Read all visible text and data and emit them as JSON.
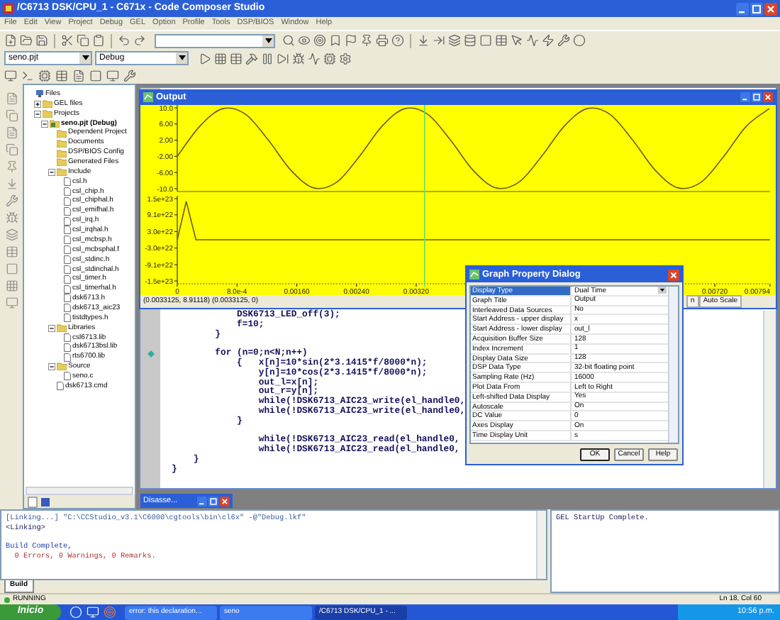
{
  "window": {
    "title": "/C6713 DSK/CPU_1 - C671x - Code Composer Studio"
  },
  "menu": [
    "File",
    "Edit",
    "View",
    "Project",
    "Debug",
    "GEL",
    "Option",
    "Profile",
    "Tools",
    "DSP/BIOS",
    "Window",
    "Help"
  ],
  "toolbar": {
    "project_combo": "seno.pjt",
    "config_combo": "Debug"
  },
  "project_tree": [
    {
      "label": "Files",
      "kind": "root",
      "children": [
        {
          "label": "GEL files",
          "kind": "folder",
          "expanded": false
        },
        {
          "label": "Projects",
          "kind": "folder",
          "expanded": true,
          "children": [
            {
              "label": "seno.pjt (Debug)",
              "kind": "project",
              "expanded": true,
              "children": [
                {
                  "label": "Dependent Project",
                  "kind": "folder"
                },
                {
                  "label": "Documents",
                  "kind": "folder"
                },
                {
                  "label": "DSP/BIOS Config",
                  "kind": "folder"
                },
                {
                  "label": "Generated Files",
                  "kind": "folder"
                },
                {
                  "label": "Include",
                  "kind": "folder",
                  "expanded": true,
                  "children": [
                    {
                      "label": "csl.h",
                      "kind": "file"
                    },
                    {
                      "label": "csl_chip.h",
                      "kind": "file"
                    },
                    {
                      "label": "csl_chiphal.h",
                      "kind": "file"
                    },
                    {
                      "label": "csl_emifhal.h",
                      "kind": "file"
                    },
                    {
                      "label": "csl_irq.h",
                      "kind": "file"
                    },
                    {
                      "label": "csl_irqhal.h",
                      "kind": "file"
                    },
                    {
                      "label": "csl_mcbsp.h",
                      "kind": "file"
                    },
                    {
                      "label": "csl_mcbsphal.f",
                      "kind": "file"
                    },
                    {
                      "label": "csl_stdinc.h",
                      "kind": "file"
                    },
                    {
                      "label": "csl_stdinchal.h",
                      "kind": "file"
                    },
                    {
                      "label": "csl_timer.h",
                      "kind": "file"
                    },
                    {
                      "label": "csl_timerhal.h",
                      "kind": "file"
                    },
                    {
                      "label": "dsk6713.h",
                      "kind": "file"
                    },
                    {
                      "label": "dsk6713_aic23",
                      "kind": "file"
                    },
                    {
                      "label": "tistdtypes.h",
                      "kind": "file"
                    }
                  ]
                },
                {
                  "label": "Libraries",
                  "kind": "folder",
                  "expanded": true,
                  "children": [
                    {
                      "label": "csl6713.lib",
                      "kind": "file"
                    },
                    {
                      "label": "dsk6713bsl.lib",
                      "kind": "file"
                    },
                    {
                      "label": "rts6700.lib",
                      "kind": "file"
                    }
                  ]
                },
                {
                  "label": "Source",
                  "kind": "folder",
                  "expanded": true,
                  "children": [
                    {
                      "label": "seno.c",
                      "kind": "file"
                    }
                  ]
                },
                {
                  "label": "dsk6713.cmd",
                  "kind": "file"
                }
              ]
            }
          ]
        }
      ]
    }
  ],
  "output_window": {
    "title": "Output",
    "upper_chart": {
      "chart_data": {
        "type": "line",
        "xlim": [
          0,
          0.00794
        ],
        "ylim": [
          -10,
          10
        ],
        "yticks": [
          {
            "value": 10,
            "label": "10.0"
          },
          {
            "value": 6,
            "label": "6.00"
          },
          {
            "value": 2,
            "label": "2.00"
          },
          {
            "value": -2,
            "label": "-2.00"
          },
          {
            "value": -6,
            "label": "-6.00"
          },
          {
            "value": -10,
            "label": "-10.0"
          }
        ],
        "x": [
          0,
          0.000305,
          0.00061,
          0.000915,
          0.00122,
          0.001525,
          0.00183,
          0.002135,
          0.00244,
          0.002745,
          0.00305,
          0.003355,
          0.00366,
          0.003965,
          0.00427,
          0.004575,
          0.00488,
          0.005185,
          0.00549,
          0.005795,
          0.0061,
          0.006405,
          0.00671,
          0.007015,
          0.00732,
          0.007625,
          0.00793
        ],
        "series": [
          {
            "color": "#6b5a10",
            "values": [
              -2,
              5.5,
              9.8,
              8.4,
              2,
              -5.5,
              -9.8,
              -8.4,
              -2,
              5.5,
              9.8,
              8.4,
              2,
              -5.5,
              -9.8,
              -8.4,
              -2,
              5.5,
              9.8,
              8.4,
              2,
              -5.5,
              -9.8,
              -8.4,
              -2,
              5.5,
              9.8
            ]
          }
        ],
        "ref_lines": [
          {
            "axis": "x",
            "value": 0.0033125,
            "color": "#66dd66"
          }
        ]
      }
    },
    "lower_chart": {
      "chart_data": {
        "type": "line",
        "xlim": [
          0,
          0.00794
        ],
        "ylim": [
          -1.5e+23,
          1.5e+23
        ],
        "yticks": [
          {
            "value": 1.5e+23,
            "label": "1.5e+23"
          },
          {
            "value": 9.1e+22,
            "label": "9.1e+22"
          },
          {
            "value": 3e+22,
            "label": "3.0e+22"
          },
          {
            "value": -3e+22,
            "label": "-3.0e+22"
          },
          {
            "value": -9.1e+22,
            "label": "-9.1e+22"
          },
          {
            "value": -1.5e+23,
            "label": "-1.5e+23"
          }
        ],
        "xticks": [
          {
            "value": 0,
            "label": "0"
          },
          {
            "value": 0.0008,
            "label": "8.0e-4"
          },
          {
            "value": 0.0016,
            "label": "0.00160"
          },
          {
            "value": 0.0024,
            "label": "0.00240"
          },
          {
            "value": 0.0032,
            "label": "0.00320"
          },
          {
            "value": 0.0072,
            "label": "0.00720"
          },
          {
            "value": 0.00794,
            "label": "0.00794"
          }
        ],
        "x": [
          0,
          0.00012,
          0.00025,
          0.00794
        ],
        "series": [
          {
            "color": "#6b5a10",
            "values": [
              0,
              1.4e+23,
              0,
              0
            ]
          }
        ],
        "ref_lines": [
          {
            "axis": "x",
            "value": 0.0033125,
            "color": "#66dd66"
          }
        ]
      }
    },
    "cursor_readout": "(0.0033125, 8.91118) (0.0033125, 0)",
    "readout_tabs": [
      "n",
      "Auto Scale"
    ]
  },
  "editor": {
    "lines": [
      {
        "text": "            DSK6713_LED_off(3);",
        "marker": false
      },
      {
        "text": "            f=10;",
        "marker": false
      },
      {
        "text": "        }",
        "marker": false
      },
      {
        "marker": false
      },
      {
        "text": "        for (n=0;n<N;n++)",
        "marker": true
      },
      {
        "text": "            {   x[n]=10*sin(2*3.1415*f/8000*n);",
        "marker": false
      },
      {
        "text": "                y[n]=10*cos(2*3.1415*f/8000*n);",
        "marker": false
      },
      {
        "text": "                out_l=x[n];",
        "marker": false
      },
      {
        "text": "                out_r=y[n];",
        "marker": false
      },
      {
        "text": "                while(!DSK6713_AIC23_write(el_handle0,",
        "marker": false
      },
      {
        "text": "                while(!DSK6713_AIC23_write(el_handle0,",
        "marker": false
      },
      {
        "text": "            }",
        "marker": false
      },
      {
        "marker": false
      },
      {
        "text": "                while(!DSK6713_AIC23_read(el_handle0,",
        "marker": false
      },
      {
        "text": "                while(!DSK6713_AIC23_read(el_handle0,",
        "marker": false
      },
      {
        "text": "    }",
        "marker": false
      },
      {
        "text": "}",
        "marker": false
      }
    ]
  },
  "minimized_window": {
    "title": "Disasse..."
  },
  "dialog": {
    "title": "Graph Property Dialog",
    "properties": [
      {
        "name": "Display Type",
        "value": "Dual Time",
        "selected": true
      },
      {
        "name": "Graph Title",
        "value": "Output",
        "selected": false
      },
      {
        "name": "Interleaved Data Sources",
        "value": "No",
        "selected": false
      },
      {
        "name": "Start Address - upper display",
        "value": "x",
        "selected": false
      },
      {
        "name": "Start Address - lower display",
        "value": "out_l",
        "selected": false
      },
      {
        "name": "Acquisition Buffer Size",
        "value": "128",
        "selected": false
      },
      {
        "name": "Index Increment",
        "value": "1",
        "selected": false
      },
      {
        "name": "Display Data Size",
        "value": "128",
        "selected": false
      },
      {
        "name": "DSP Data Type",
        "value": "32-bit floating point",
        "selected": false
      },
      {
        "name": "Sampling Rate (Hz)",
        "value": "16000",
        "selected": false
      },
      {
        "name": "Plot Data From",
        "value": "Left to Right",
        "selected": false
      },
      {
        "name": "Left-shifted Data Display",
        "value": "Yes",
        "selected": false
      },
      {
        "name": "Autoscale",
        "value": "On",
        "selected": false
      },
      {
        "name": "DC Value",
        "value": "0",
        "selected": false
      },
      {
        "name": "Axes Display",
        "value": "On",
        "selected": false
      },
      {
        "name": "Time Display Unit",
        "value": "s",
        "selected": false
      }
    ],
    "buttons": [
      "OK",
      "Cancel",
      "Help"
    ]
  },
  "build_output": {
    "lines": [
      {
        "kind": "command",
        "text": "[Linking...] \"C:\\CCStudio_v3.1\\C6000\\cgtools\\bin\\cl6x\" -@\"Debug.lkf\""
      },
      {
        "kind": "info",
        "text": "<Linking>"
      },
      {
        "kind": "blank"
      },
      {
        "kind": "summary",
        "text": "Build Complete,"
      },
      {
        "kind": "result",
        "text": "  0 Errors, 0 Warnings, 0 Remarks."
      }
    ],
    "tabs": [
      {
        "label": "Build",
        "selected": true
      }
    ]
  },
  "gel_output": {
    "lines": [
      "GEL StartUp Complete."
    ]
  },
  "status_bar": {
    "state": "RUNNING",
    "position": "Ln 18, Col 60"
  },
  "taskbar": {
    "start": "Inicio",
    "tasks": [
      {
        "label": "error: this declaration...",
        "selected": false
      },
      {
        "label": "seno",
        "selected": false
      },
      {
        "label": "/C6713 DSK/CPU_1 - ...",
        "selected": true
      }
    ],
    "clock": "10:56 p.m."
  }
}
